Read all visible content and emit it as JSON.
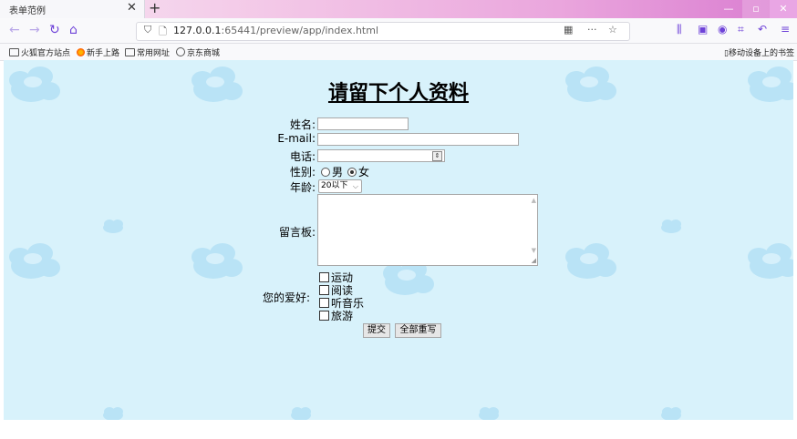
{
  "browser": {
    "tab_title": "表单范例",
    "tab_close": "✕",
    "new_tab": "+",
    "url_prefix": "127.0.0.1",
    "url_rest": ":65441/preview/app/index.html",
    "win_min": "—",
    "win_max": "▫",
    "win_close": "✕",
    "bookmarks": [
      "火狐官方站点",
      "新手上路",
      "常用网址",
      "京东商城"
    ],
    "mobile_bookmarks": "移动设备上的书签",
    "icons": [
      "back-icon",
      "forward-icon",
      "reload-icon",
      "home-icon",
      "shield-icon",
      "page-icon",
      "qr-icon",
      "more-icon",
      "star-icon",
      "library-icon",
      "sidebar-icon",
      "account-icon",
      "screenshot-icon",
      "undo-icon",
      "menu-icon"
    ]
  },
  "form": {
    "title": "请留下个人资料",
    "name_label": "姓名:",
    "email_label": "E-mail:",
    "phone_label": "电话:",
    "gender_label": "性别:",
    "gender_options": [
      "男",
      "女"
    ],
    "gender_selected": "女",
    "age_label": "年龄:",
    "age_value": "20以下",
    "message_label": "留言板:",
    "hobby_label": "您的爱好:",
    "hobbies": [
      "运动",
      "阅读",
      "听音乐",
      "旅游"
    ],
    "submit_label": "提交",
    "reset_label": "全部重写"
  },
  "colors": {
    "page_bg": "#d8f2fb",
    "cloud": "#b9e3f6",
    "accent": "#6e42d8"
  }
}
